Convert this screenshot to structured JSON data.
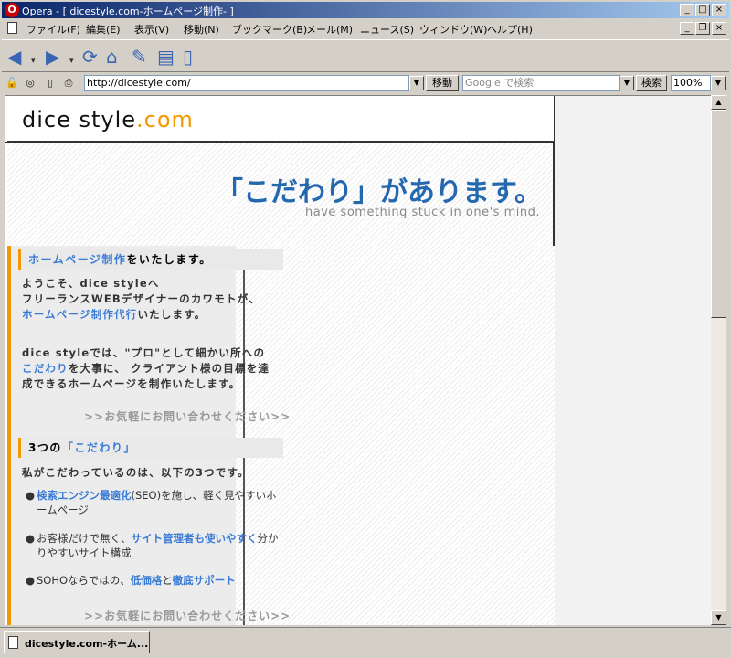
{
  "window": {
    "title": "Opera - [ dicestyle.com-ホームページ制作- ]",
    "app_icon": "opera-icon"
  },
  "menu": {
    "items": [
      "ファイル(F)",
      "編集(E)",
      "表示(V)",
      "移動(N)",
      "ブックマーク(B)",
      "メール(M)",
      "ニュース(S)",
      "ウィンドウ(W)",
      "ヘルプ(H)"
    ]
  },
  "toolbar": {
    "buttons": [
      "back-icon",
      "forward-icon",
      "reload-icon",
      "home-icon",
      "bookmarks-icon",
      "print-icon",
      "page-icon"
    ]
  },
  "address": {
    "url": "http://dicestyle.com/",
    "go_label": "移動",
    "search_placeholder": "Google で検索",
    "search_label": "検索",
    "zoom": "100%"
  },
  "page": {
    "logo_main": "dice style",
    "logo_com": ".com",
    "catch": "「こだわり」があります。",
    "catch_sub": "have something stuck in one's mind.",
    "section1": {
      "heading_hl": "ホームページ制作",
      "heading_rest": "をいたします。",
      "p1_l1": "ようこそ、dice styleへ",
      "p1_l2": "フリーランスWEBデザイナーのカワモトが、",
      "p1_l3_hl": "ホームページ制作代行",
      "p1_l3_rest": "いたします。",
      "p2_l1": "dice styleでは、\"プロ\"として細かい所への",
      "p2_l2_hl": "こだわり",
      "p2_l2_rest": "を大事に、 クライアント様の目標を達",
      "p2_l3": "成できるホームページを制作いたします。",
      "contact": ">>お気軽にお問い合わせください>>"
    },
    "section2": {
      "heading_pre": "3つの",
      "heading_hl": "「こだわり」",
      "intro": "私がこだわっているのは、以下の3つです。",
      "b1_hl": "検索エンジン最適化",
      "b1_rest": "(SEO)を施し、軽く見やすいホ",
      "b1_l2": "ームページ",
      "b2_pre": "お客様だけで無く、",
      "b2_hl": "サイト管理者も使いやすく",
      "b2_rest": "分か",
      "b2_l2": "りやすいサイト構成",
      "b3_pre": "SOHOならではの、",
      "b3_hl1": "低価格",
      "b3_mid": "と",
      "b3_hl2": "徹底サポート",
      "contact": ">>お気軽にお問い合わせください>>"
    }
  },
  "tabs": [
    {
      "label": "dicestyle.com-ホーム..."
    }
  ]
}
